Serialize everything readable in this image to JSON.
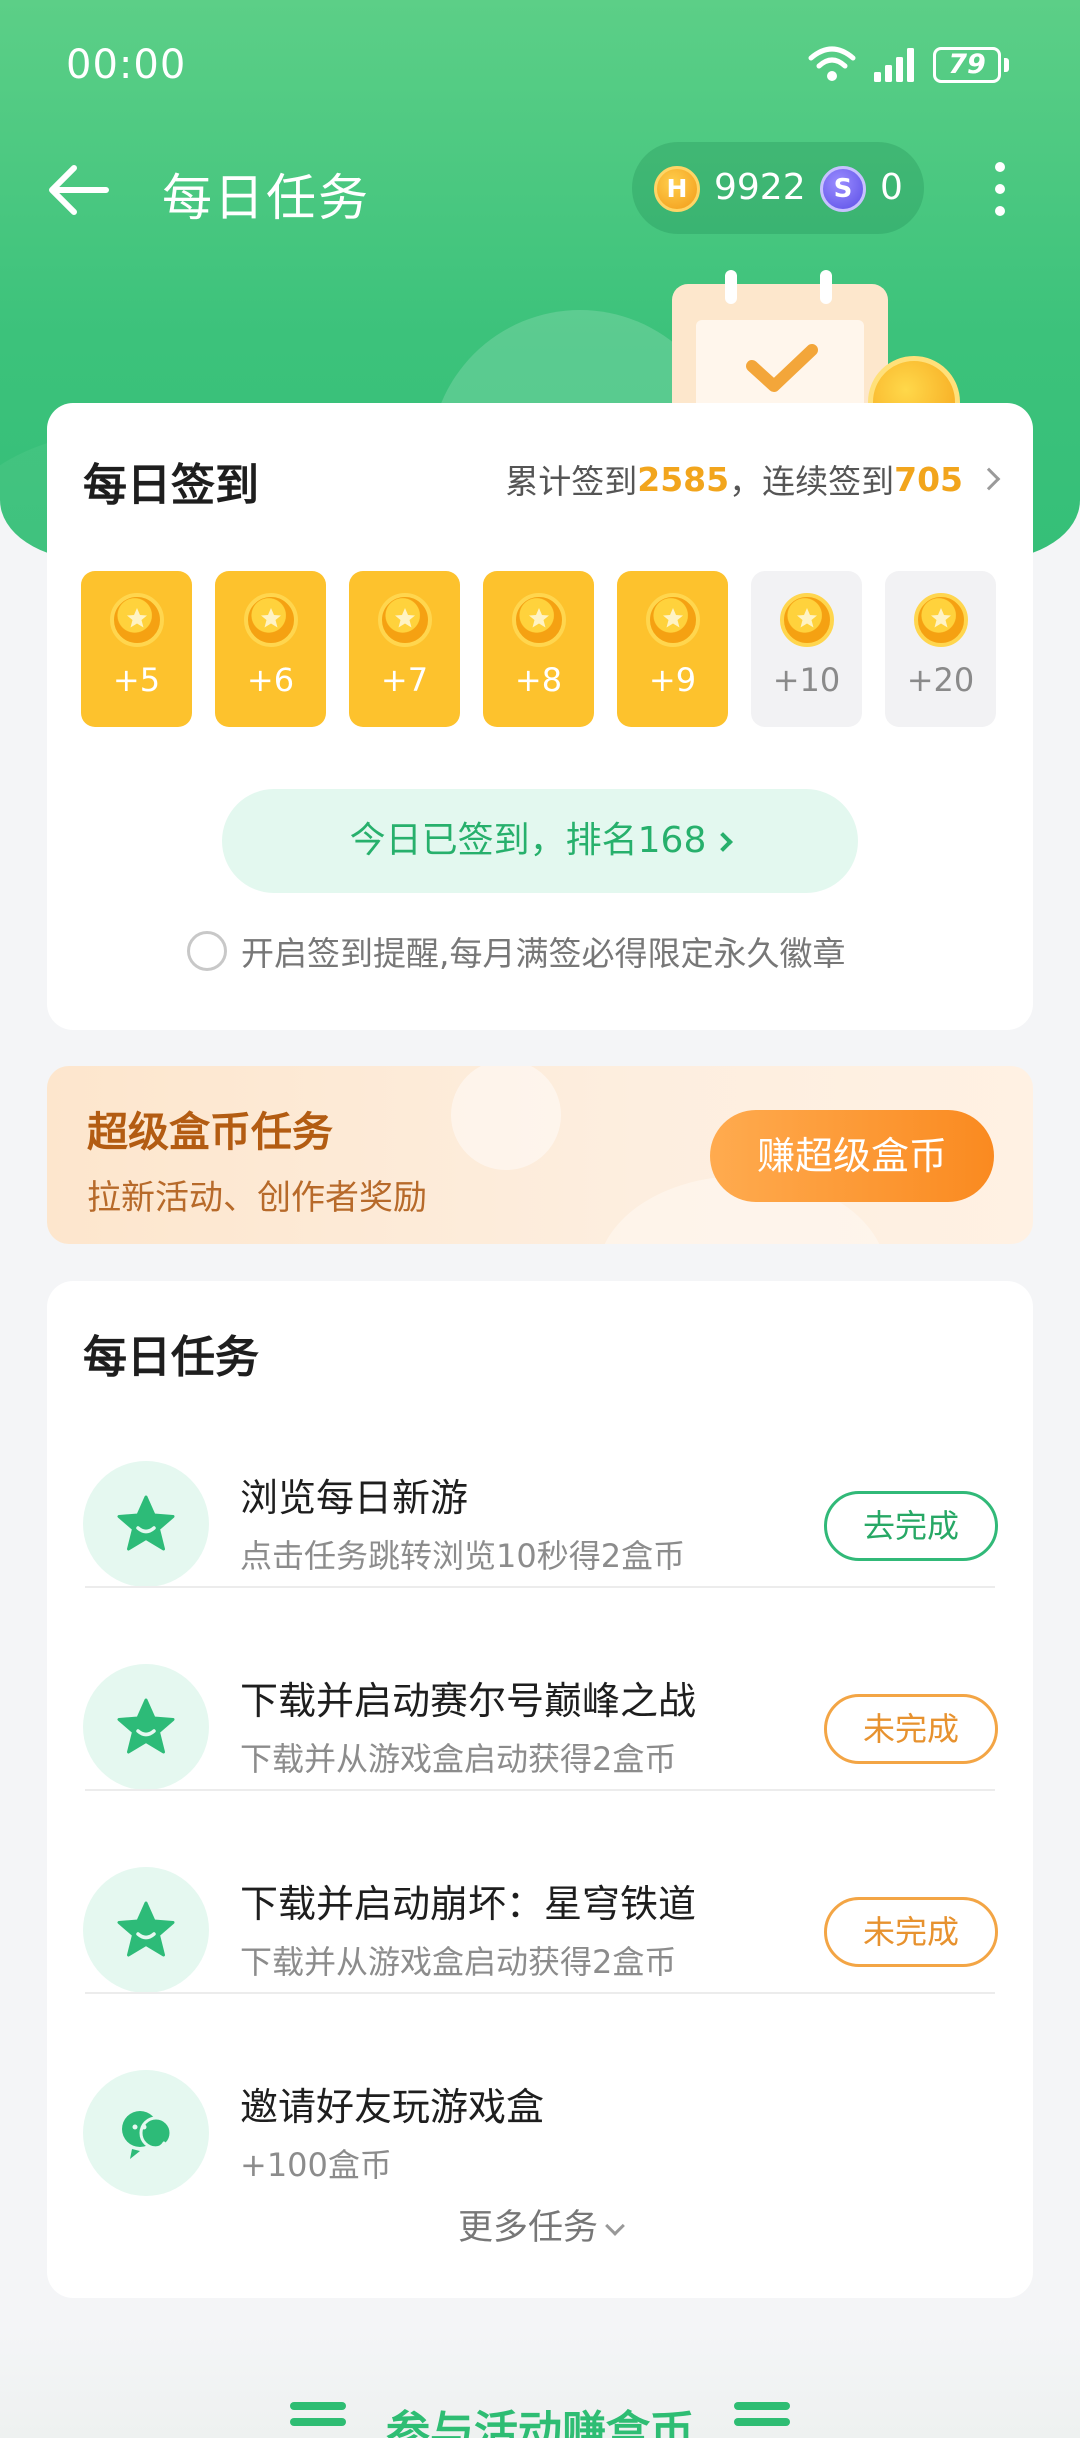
{
  "status_bar": {
    "time": "00:00",
    "battery": "79"
  },
  "header": {
    "title": "每日任务",
    "h_coin_label": "H",
    "h_coins": "9922",
    "s_coin_label": "S",
    "s_coins": "0"
  },
  "signin": {
    "title": "每日签到",
    "stats_prefix": "累计签到 ",
    "total_days": "2585",
    "stats_middle": "，连续签到 ",
    "streak_days": "705",
    "days": [
      {
        "amount": "+5",
        "done": true
      },
      {
        "amount": "+6",
        "done": true
      },
      {
        "amount": "+7",
        "done": true
      },
      {
        "amount": "+8",
        "done": true
      },
      {
        "amount": "+9",
        "done": true
      },
      {
        "amount": "+10",
        "done": false
      },
      {
        "amount": "+20",
        "done": false
      }
    ],
    "signed_button": "今日已签到，排名168",
    "reminder_text": "开启签到提醒,每月满签必得限定永久徽章"
  },
  "super_task": {
    "title": "超级盒币任务",
    "subtitle": "拉新活动、创作者奖励",
    "button": "赚超级盒币"
  },
  "daily_tasks": {
    "title": "每日任务",
    "items": [
      {
        "title": "浏览每日新游",
        "subtitle": "点击任务跳转浏览10秒得2盒币",
        "button": "去完成",
        "state": "go",
        "icon": "star-icon"
      },
      {
        "title": "下载并启动赛尔号巅峰之战",
        "subtitle": "下载并从游戏盒启动获得2盒币",
        "button": "未完成",
        "state": "undone",
        "icon": "star-icon"
      },
      {
        "title": "下载并启动崩坏：星穹铁道",
        "subtitle": "下载并从游戏盒启动获得2盒币",
        "button": "未完成",
        "state": "undone",
        "icon": "star-icon"
      },
      {
        "title": "邀请好友玩游戏盒",
        "subtitle": "+100盒币",
        "button": "",
        "state": "none",
        "icon": "invite-friends-icon"
      }
    ],
    "more_label": "更多任务"
  },
  "bottom_banner": {
    "text": "参与活动赚盒币"
  },
  "colors": {
    "brand_green": "#3cc27b",
    "coin_gold": "#fdc22d",
    "stat_orange": "#f2a51c",
    "undone_orange": "#e7922f"
  }
}
